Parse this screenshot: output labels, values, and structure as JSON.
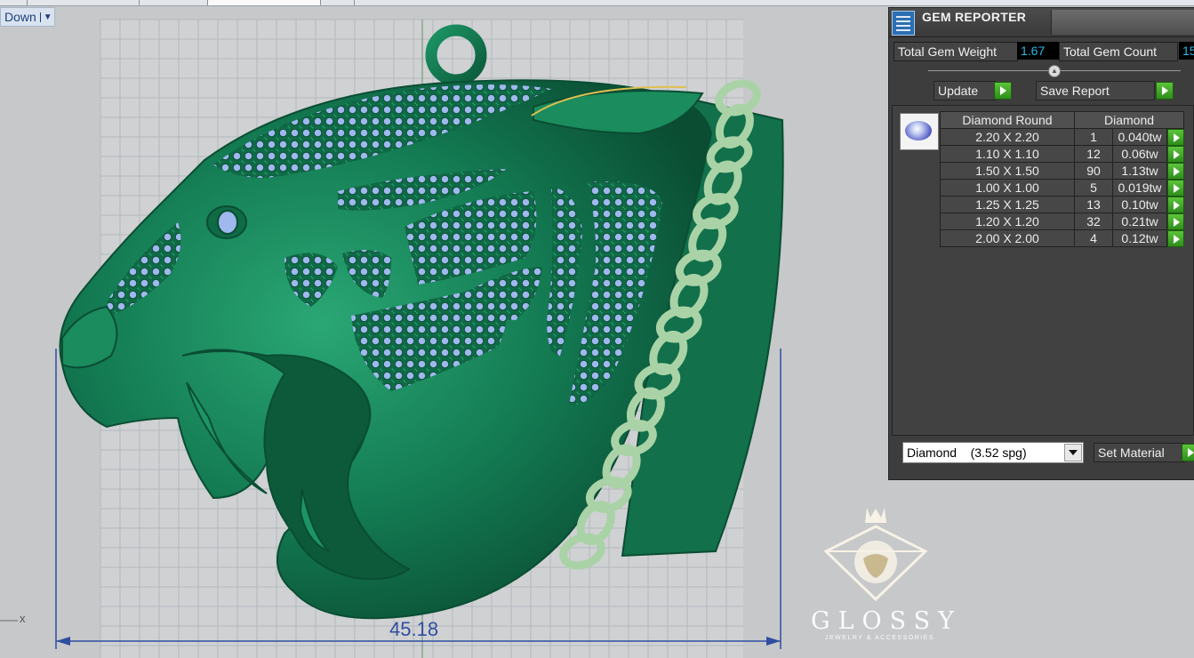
{
  "viewport": {
    "label": "Down",
    "dimension": "45.18",
    "axis_label": "x"
  },
  "gem_reporter": {
    "title": "GEM REPORTER",
    "total_weight_label": "Total Gem Weight",
    "total_weight_value": "1.67",
    "total_count_label": "Total Gem Count",
    "total_count_value": "15",
    "update_label": "Update",
    "save_report_label": "Save Report",
    "table_headers": [
      "Diamond Round",
      "Diamond"
    ],
    "rows": [
      {
        "size": "2.20 X 2.20",
        "count": "1",
        "weight": "0.040tw"
      },
      {
        "size": "1.10 X 1.10",
        "count": "12",
        "weight": "0.06tw"
      },
      {
        "size": "1.50 X 1.50",
        "count": "90",
        "weight": "1.13tw"
      },
      {
        "size": "1.00 X 1.00",
        "count": "5",
        "weight": "0.019tw"
      },
      {
        "size": "1.25 X 1.25",
        "count": "13",
        "weight": "0.10tw"
      },
      {
        "size": "1.20 X 1.20",
        "count": "32",
        "weight": "0.21tw"
      },
      {
        "size": "2.00 X 2.00",
        "count": "4",
        "weight": "0.12tw"
      }
    ],
    "material_value": "Diamond    (3.52 spg)",
    "set_material_label": "Set Material"
  },
  "watermark": {
    "name": "GLOSSY",
    "subtitle": "JEWELRY & ACCESSORIES"
  },
  "colors": {
    "metal": "#137a52",
    "gem": "#9fb8ee",
    "chain": "#a9d3a6",
    "dimension": "#2f4ea0",
    "gem_value": "#29b8e6"
  }
}
